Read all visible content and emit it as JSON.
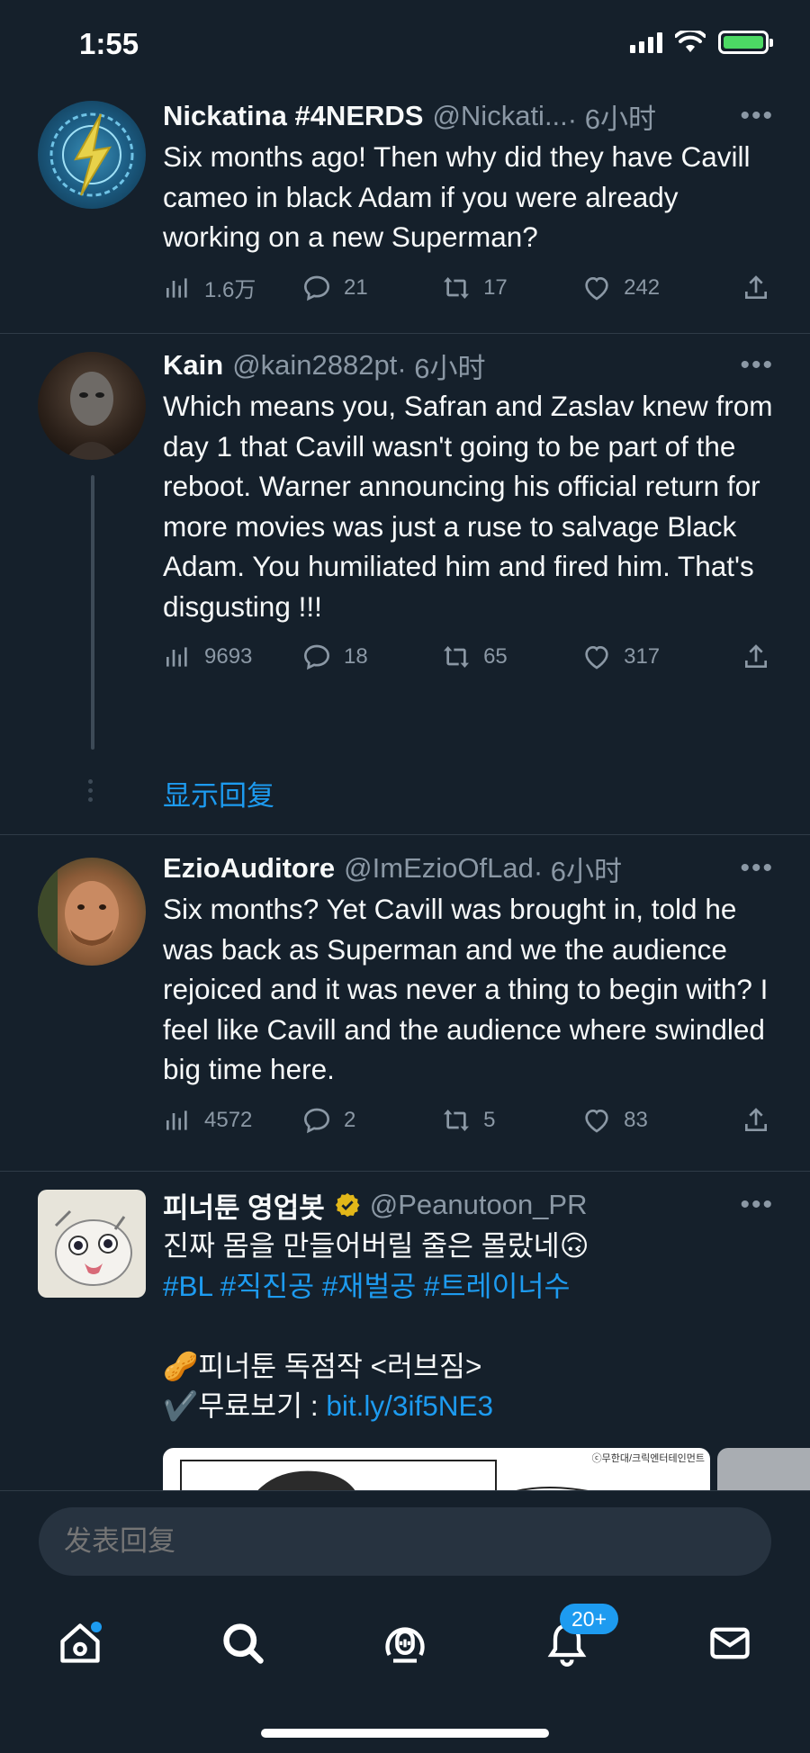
{
  "status_bar": {
    "time": "1:55"
  },
  "tweets": [
    {
      "name": "Nickatina #4NERDS",
      "handle": "@Nickati...",
      "time": " · 6小时",
      "text": "Six months ago! Then why did they have Cavill cameo in black Adam if you were already working on a new Superman?",
      "views": "1.6万",
      "replies": "21",
      "retweets": "17",
      "likes": "242"
    },
    {
      "name": "Kain",
      "handle": "@kain2882pt",
      "time": " · 6小时",
      "text": "Which means you, Safran and Zaslav knew from day 1 that Cavill wasn't going to be part of the reboot. Warner announcing his official return for more movies was just a ruse to salvage Black Adam. You humiliated him and fired him. That's disgusting !!!",
      "views": "9693",
      "replies": "18",
      "retweets": "65",
      "likes": "317",
      "show_replies": "显示回复"
    },
    {
      "name": "EzioAuditore",
      "handle": "@ImEzioOfLad",
      "time": " · 6小时",
      "text": "Six months? Yet Cavill was brought in, told he was back as Superman and we the audience rejoiced and it was never a thing to begin with? I feel like Cavill and the audience where swindled big time here.",
      "views": "4572",
      "replies": "2",
      "retweets": "5",
      "likes": "83"
    },
    {
      "name": "피너툰 영업봇",
      "handle": "@Peanutoon_PR",
      "line1": "진짜 몸을 만들어버릴 줄은 몰랐네🙃",
      "hashtags": "#BL #직진공 #재벌공 #트레이너수",
      "line2": "🥜피너툰 독점작 <러브짐>",
      "line3_prefix": "✔️무료보기 : ",
      "link": "bit.ly/3if5NE3",
      "media_credit": "ⓒ무한대/크릭엔터테인먼트"
    }
  ],
  "reply_bar": {
    "placeholder": "发表回复"
  },
  "tabbar": {
    "notifications_badge": "20+"
  },
  "colors": {
    "background": "#15202b",
    "accent": "#1d9bf0",
    "muted": "#8b98a5"
  }
}
